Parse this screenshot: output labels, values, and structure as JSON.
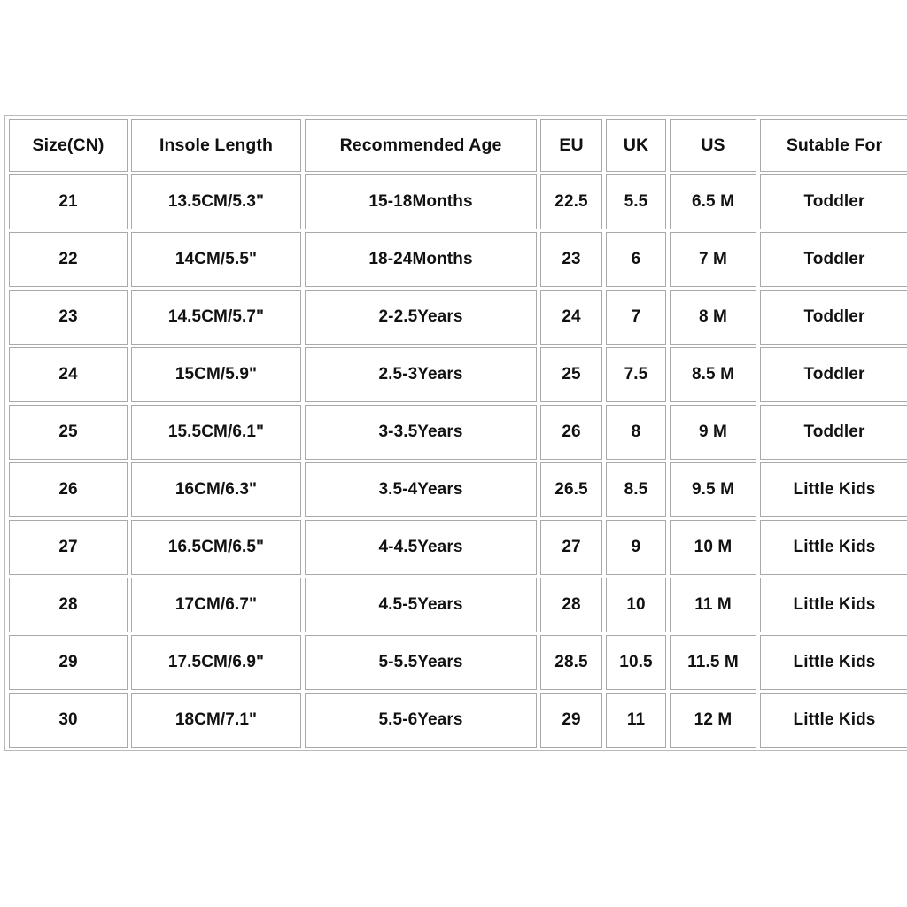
{
  "table": {
    "columns": [
      {
        "key": "size",
        "label": "Size(CN)"
      },
      {
        "key": "insole",
        "label": "Insole Length"
      },
      {
        "key": "age",
        "label": "Recommended Age"
      },
      {
        "key": "eu",
        "label": "EU"
      },
      {
        "key": "uk",
        "label": "UK"
      },
      {
        "key": "us",
        "label": "US"
      },
      {
        "key": "for",
        "label": "Sutable For"
      }
    ],
    "rows": [
      {
        "size": "21",
        "insole": "13.5CM/5.3\"",
        "age": "15-18Months",
        "eu": "22.5",
        "uk": "5.5",
        "us": "6.5 M",
        "for": "Toddler"
      },
      {
        "size": "22",
        "insole": "14CM/5.5\"",
        "age": "18-24Months",
        "eu": "23",
        "uk": "6",
        "us": "7 M",
        "for": "Toddler"
      },
      {
        "size": "23",
        "insole": "14.5CM/5.7\"",
        "age": "2-2.5Years",
        "eu": "24",
        "uk": "7",
        "us": "8 M",
        "for": "Toddler"
      },
      {
        "size": "24",
        "insole": "15CM/5.9\"",
        "age": "2.5-3Years",
        "eu": "25",
        "uk": "7.5",
        "us": "8.5 M",
        "for": "Toddler"
      },
      {
        "size": "25",
        "insole": "15.5CM/6.1\"",
        "age": "3-3.5Years",
        "eu": "26",
        "uk": "8",
        "us": "9 M",
        "for": "Toddler"
      },
      {
        "size": "26",
        "insole": "16CM/6.3\"",
        "age": "3.5-4Years",
        "eu": "26.5",
        "uk": "8.5",
        "us": "9.5 M",
        "for": "Little Kids"
      },
      {
        "size": "27",
        "insole": "16.5CM/6.5\"",
        "age": "4-4.5Years",
        "eu": "27",
        "uk": "9",
        "us": "10 M",
        "for": "Little Kids"
      },
      {
        "size": "28",
        "insole": "17CM/6.7\"",
        "age": "4.5-5Years",
        "eu": "28",
        "uk": "10",
        "us": "11 M",
        "for": "Little Kids"
      },
      {
        "size": "29",
        "insole": "17.5CM/6.9\"",
        "age": "5-5.5Years",
        "eu": "28.5",
        "uk": "10.5",
        "us": "11.5 M",
        "for": "Little Kids"
      },
      {
        "size": "30",
        "insole": "18CM/7.1\"",
        "age": "5.5-6Years",
        "eu": "29",
        "uk": "11",
        "us": "12 M",
        "for": "Little Kids"
      }
    ]
  },
  "colors": {
    "background": "#ffffff",
    "cell_border": "#a9a9a9",
    "table_border": "#b9b9b9",
    "text": "#111111"
  }
}
